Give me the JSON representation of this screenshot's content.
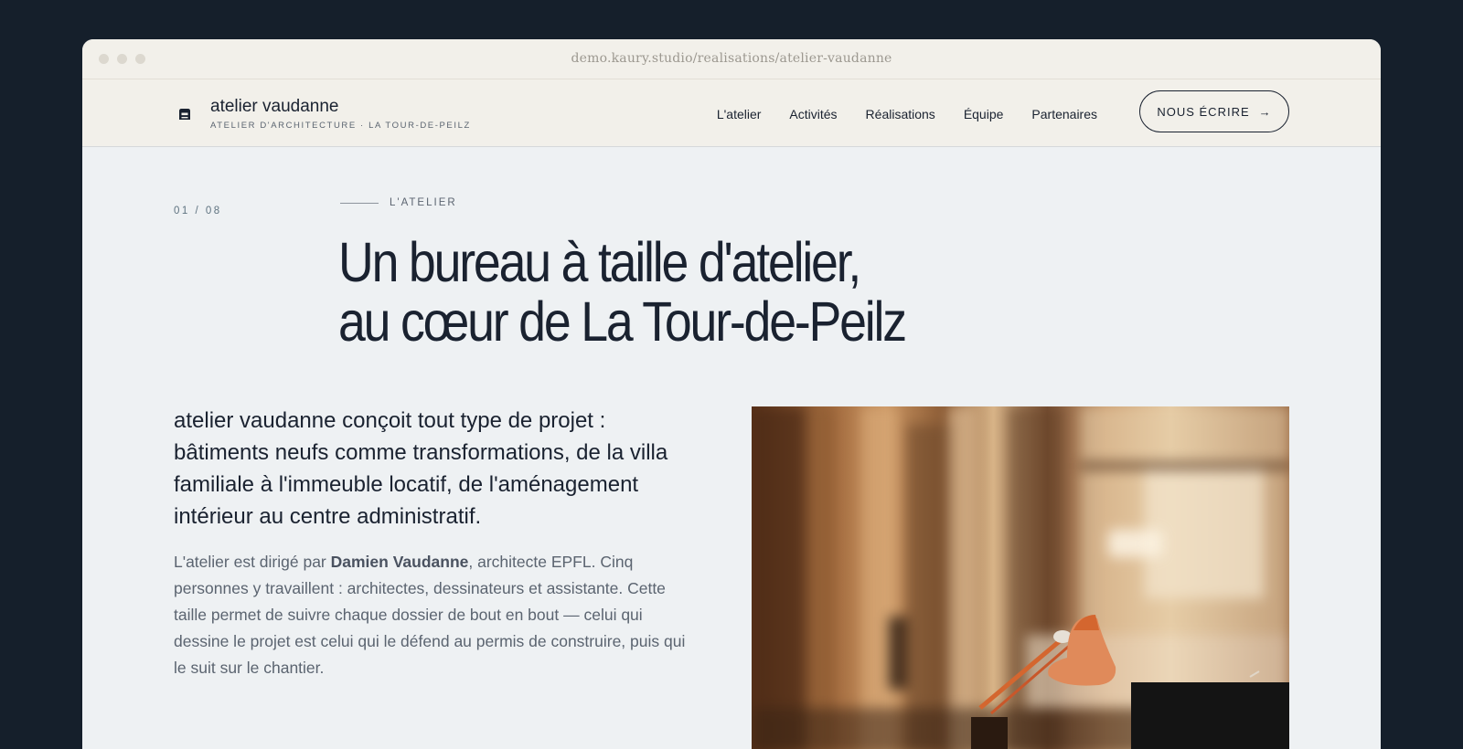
{
  "browser": {
    "url": "demo.kaury.studio/realisations/atelier-vaudanne"
  },
  "header": {
    "brand_name": "atelier vaudanne",
    "brand_tagline": "ATELIER D'ARCHITECTURE · LA TOUR-DE-PEILZ",
    "logo_icon": "house-arch-logo-icon",
    "nav": [
      {
        "label": "L'atelier"
      },
      {
        "label": "Activités"
      },
      {
        "label": "Réalisations"
      },
      {
        "label": "Équipe"
      },
      {
        "label": "Partenaires"
      }
    ],
    "cta_label": "NOUS ÉCRIRE",
    "cta_arrow": "→"
  },
  "section": {
    "counter": "01 / 08",
    "eyebrow": "L'ATELIER",
    "headline_line1": "Un bureau à taille d'atelier,",
    "headline_line2": "au cœur de La Tour-de-Peilz",
    "lead": "atelier vaudanne conçoit tout type de projet : bâtiments neufs comme transformations, de la villa familiale à l'immeuble locatif, de l'aménagement intérieur au centre administratif.",
    "body_pre": "L'atelier est dirigé par ",
    "body_bold": "Damien Vaudanne",
    "body_post": ", architecte EPFL. Cinq personnes y travaillent : architectes, dessinateurs et assistante. Cette taille permet de suivre chaque dossier de bout en bout — celui qui dessine le projet est celui qui le défend au permis de construire, puis qui le suit sur le chantier."
  },
  "colors": {
    "page_background": "#151f2b",
    "header_background": "#f2f0ea",
    "content_background": "#eef1f3",
    "text_primary": "#1a2230",
    "text_muted": "#5b6470",
    "lamp_accent": "#d4662f"
  }
}
